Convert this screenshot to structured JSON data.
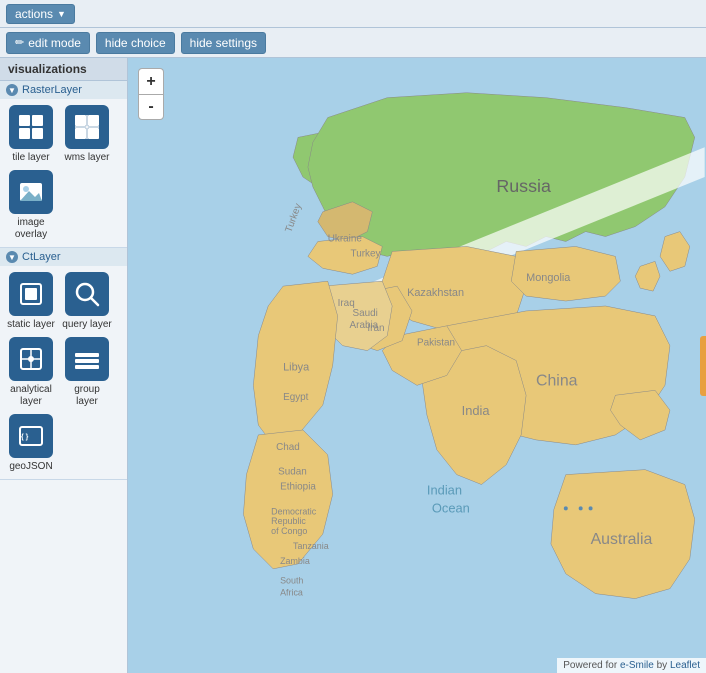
{
  "topbar": {
    "actions_label": "actions",
    "actions_arrow": "▼"
  },
  "toolbar": {
    "edit_mode_label": "edit mode",
    "edit_icon": "✏",
    "hide_choice_label": "hide choice",
    "hide_settings_label": "hide settings"
  },
  "left_panel": {
    "visualizations_label": "visualizations",
    "raster_layer_label": "RasterLayer",
    "ct_layer_label": "CtLayer",
    "items": [
      {
        "id": "tile-layer",
        "label": "tile layer",
        "section": "raster"
      },
      {
        "id": "wms-layer",
        "label": "wms layer",
        "section": "raster"
      },
      {
        "id": "image-overlay",
        "label": "image overlay",
        "section": "raster"
      },
      {
        "id": "static-layer",
        "label": "static layer",
        "section": "ct"
      },
      {
        "id": "query-layer",
        "label": "query layer",
        "section": "ct"
      },
      {
        "id": "analytical-layer",
        "label": "analytical layer",
        "section": "ct"
      },
      {
        "id": "group-layer",
        "label": "group layer",
        "section": "ct"
      },
      {
        "id": "geojson",
        "label": "geoJSON",
        "section": "ct"
      }
    ]
  },
  "map": {
    "zoom_in": "+",
    "zoom_out": "-"
  },
  "attribution": {
    "text": "Powered for ",
    "esmile": "e-Smile",
    "by": " by ",
    "leaflet": "Leaflet"
  }
}
